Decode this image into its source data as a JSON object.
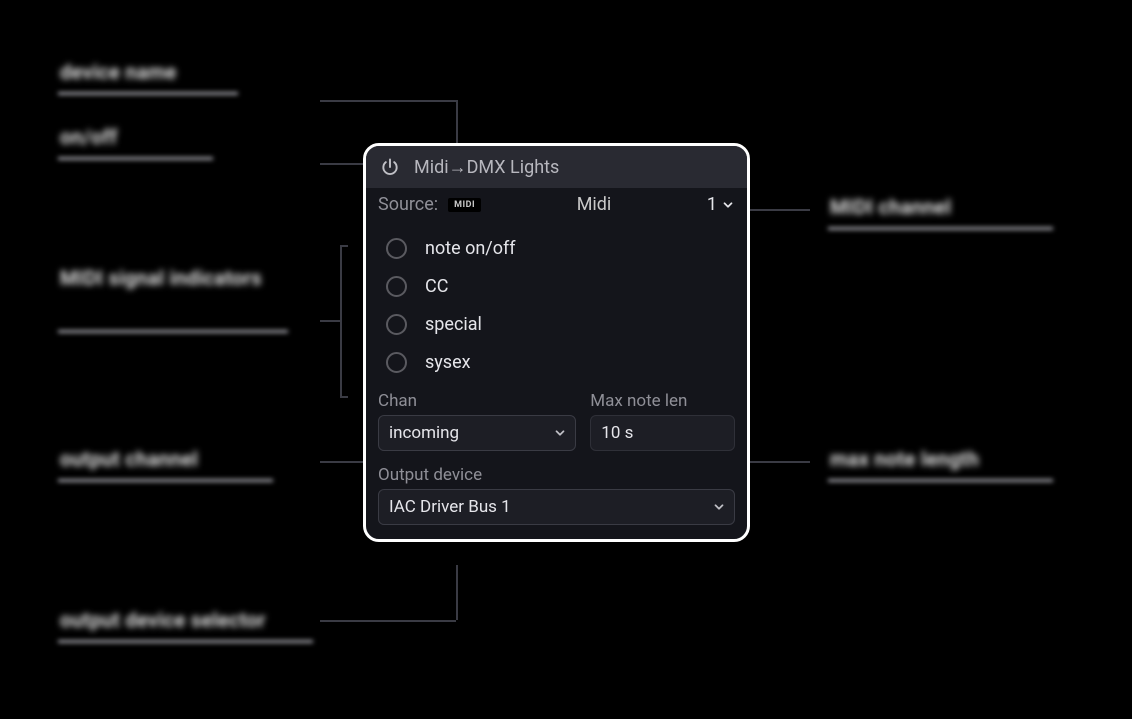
{
  "panel": {
    "title": "Midi→DMX Lights",
    "source": {
      "label": "Source:",
      "badge": "MIDI",
      "name": "Midi",
      "channel": "1"
    },
    "signals": [
      "note on/off",
      "CC",
      "special",
      "sysex"
    ],
    "chan": {
      "label": "Chan",
      "value": "incoming"
    },
    "max_note_len": {
      "label": "Max note len",
      "value": "10 s"
    },
    "output_device": {
      "label": "Output device",
      "value": "IAC Driver Bus 1"
    }
  },
  "annotations": {
    "top_left_1": "device name",
    "top_left_2": "on/off",
    "mid_left": "MIDI signal indicators",
    "chan_left": "output channel",
    "device_bottom": "output device selector",
    "right_top": "MIDI channel",
    "right_mid": "max note length"
  }
}
